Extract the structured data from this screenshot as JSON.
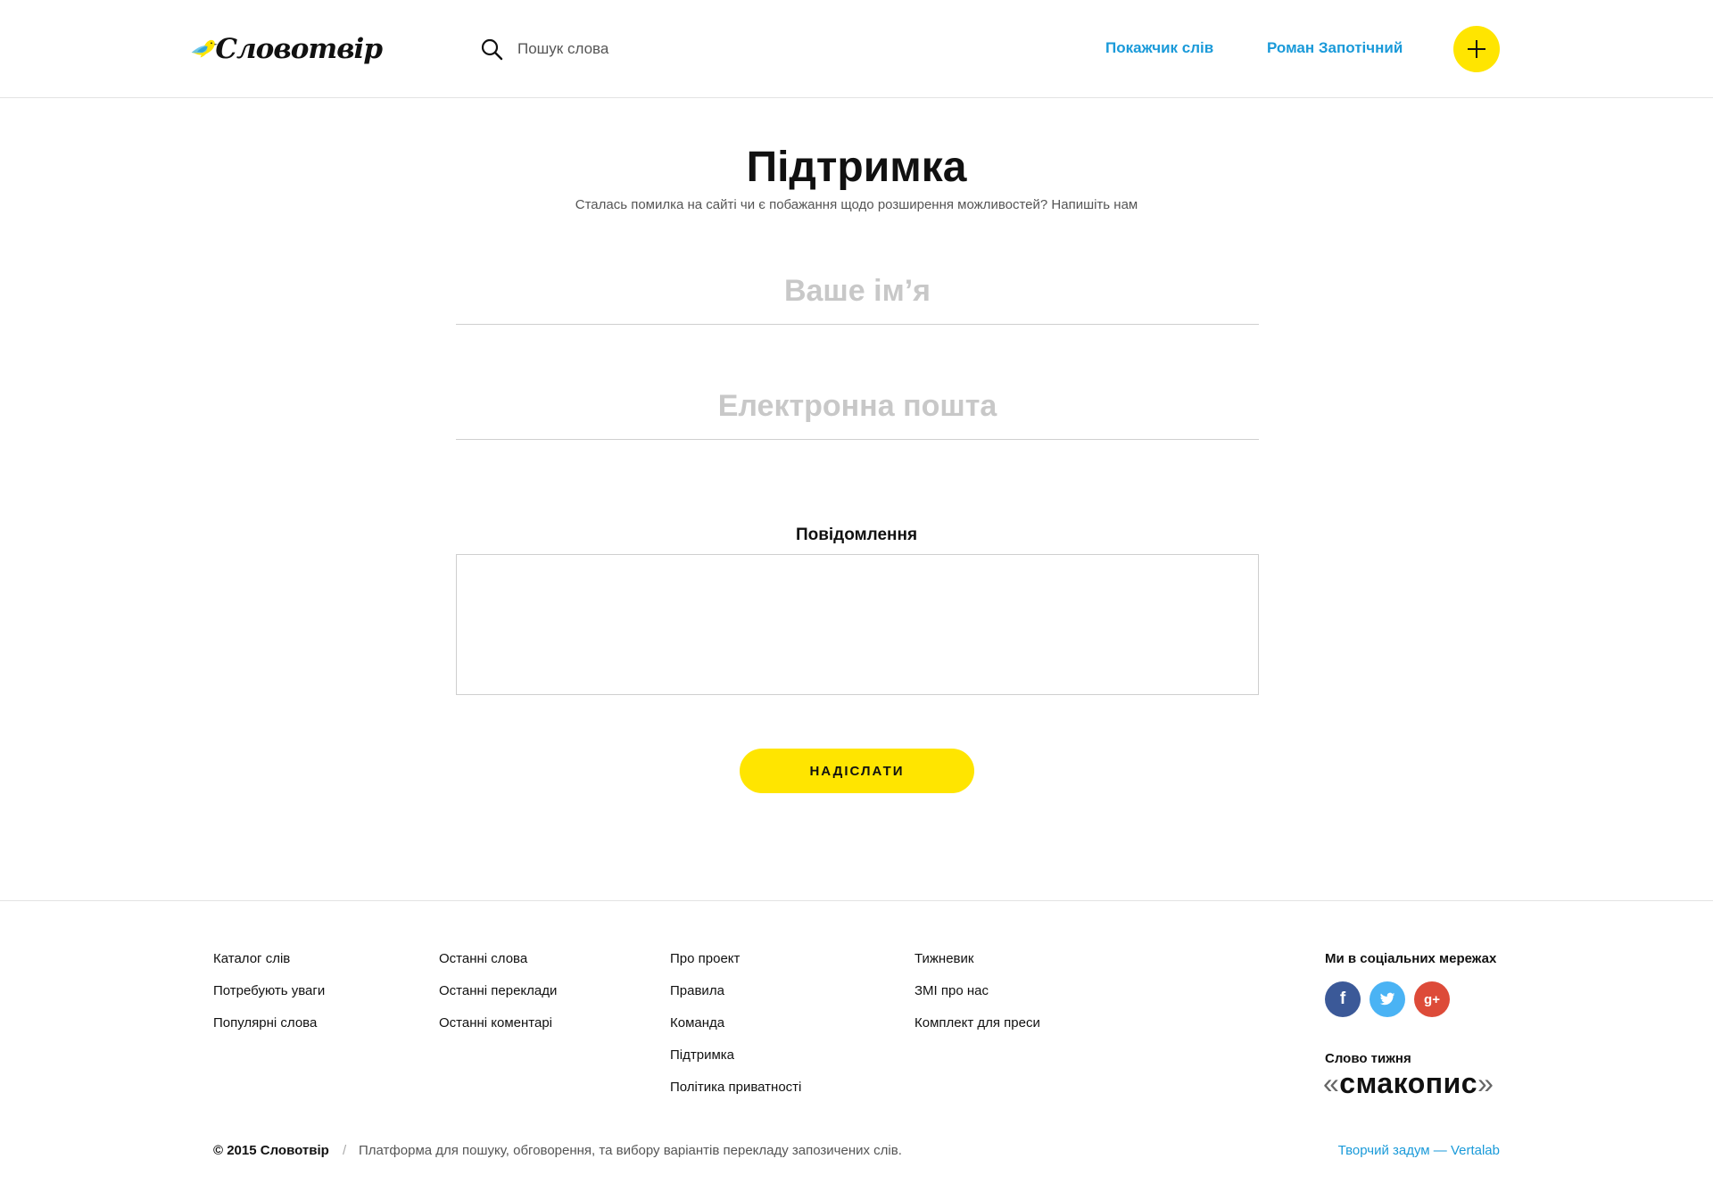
{
  "header": {
    "logo_text": "Словотвір",
    "search_placeholder": "Пошук слова",
    "nav_index": "Покажчик слів",
    "nav_user": "Роман Запотічний",
    "add_icon": "plus-icon"
  },
  "main": {
    "title": "Підтримка",
    "subtitle": "Сталась помилка на сайті чи є побажання щодо розширення можливостей? Напишіть нам",
    "name_placeholder": "Ваше ім’я",
    "email_placeholder": "Електронна пошта",
    "message_label": "Повідомлення",
    "message_value": "",
    "send_label": "НАДІСЛАТИ"
  },
  "footer": {
    "col1": [
      "Каталог слів",
      "Потребують уваги",
      "Популярні слова"
    ],
    "col2": [
      "Останні слова",
      "Останні переклади",
      "Останні коментарі"
    ],
    "col3": [
      "Про проект",
      "Правила",
      "Команда",
      "Підтримка",
      "Політика приватності"
    ],
    "col4": [
      "Тижневик",
      "ЗМІ про нас",
      "Комплект для преси"
    ],
    "social_title": "Ми в соціальних мережах",
    "social": [
      {
        "name": "facebook",
        "icon": "facebook-icon",
        "color": "#3b5998"
      },
      {
        "name": "twitter",
        "icon": "twitter-icon",
        "color": "#4ab3f4"
      },
      {
        "name": "google-plus",
        "icon": "google-plus-icon",
        "color": "#dd4b39"
      }
    ],
    "word_of_week_title": "Слово тижня",
    "word_of_week": "смакопис",
    "copyright": "© 2015 Словотвір",
    "separator": "/",
    "tagline": "Платформа для пошуку, обговорення, та вибору варіантів перекладу запозичених слів.",
    "credit": "Творчий задум — Vertalab"
  },
  "colors": {
    "accent_yellow": "#ffe500",
    "link_blue": "#1a9ad9"
  }
}
